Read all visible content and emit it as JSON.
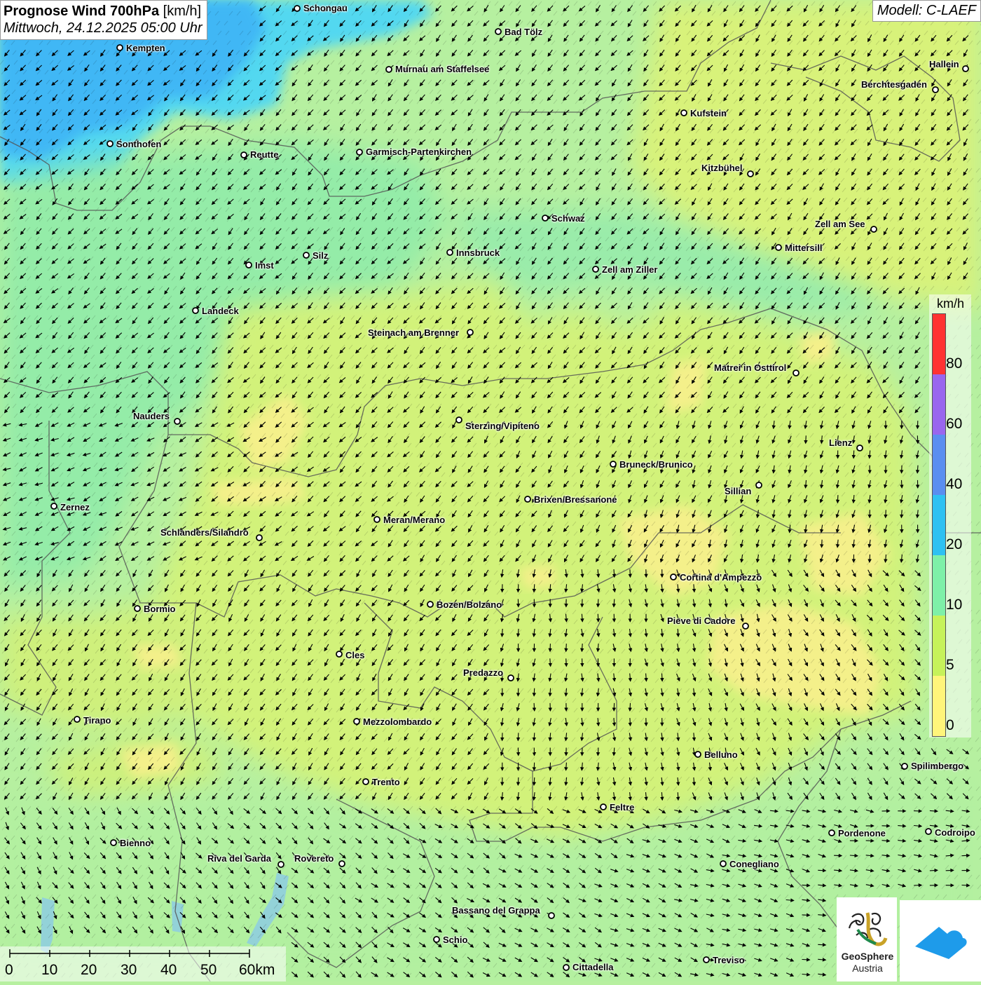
{
  "header": {
    "title": "Prognose Wind 700hPa",
    "unit": "[km/h]",
    "datetime": "Mittwoch, 24.12.2025 05:00 Uhr"
  },
  "model": "Modell: C-LAEF",
  "colors": {
    "calm_yellow": "#f4f08a",
    "low_green_yellow": "#d2f27a",
    "mid_green": "#a8f2a2",
    "teal_green": "#86eaa8",
    "sky_blue": "#52d8f0",
    "deep_blue": "#3fb7f5",
    "border_line": "#555555"
  },
  "legend": {
    "unit": "km/h",
    "labels": [
      "80",
      "60",
      "40",
      "20",
      "10",
      "5",
      "0"
    ],
    "segments": [
      {
        "color": "#ff3232"
      },
      {
        "color": "#9966ee"
      },
      {
        "color": "#5a8ef0"
      },
      {
        "color": "#2ec1f2"
      },
      {
        "color": "#7ef0a8"
      },
      {
        "color": "#c6f25a"
      },
      {
        "color": "#fff57a"
      }
    ]
  },
  "scale": {
    "labels": [
      "0",
      "10",
      "20",
      "30",
      "40",
      "50",
      "60km"
    ]
  },
  "logos": {
    "geosphere_line1": "GeoSphere",
    "geosphere_line2": "Austria",
    "geosphere_icon": "geosphere-swirl-icon",
    "app_icon": "weather-app-cloud-icon"
  },
  "cities": [
    {
      "name": "Schongau"
    },
    {
      "name": "Kempten"
    },
    {
      "name": "Bad Tölz"
    },
    {
      "name": "Murnau am Staffelsee"
    },
    {
      "name": "Hallein"
    },
    {
      "name": "Berchtesgaden"
    },
    {
      "name": "Kufstein"
    },
    {
      "name": "Sonthofen"
    },
    {
      "name": "Reutte"
    },
    {
      "name": "Garmisch-Partenkirchen"
    },
    {
      "name": "Kitzbühel"
    },
    {
      "name": "Schwaz"
    },
    {
      "name": "Zell am See"
    },
    {
      "name": "Mittersill"
    },
    {
      "name": "Innsbruck"
    },
    {
      "name": "Silz"
    },
    {
      "name": "Imst"
    },
    {
      "name": "Zell am Ziller"
    },
    {
      "name": "Landeck"
    },
    {
      "name": "Steinach am Brenner"
    },
    {
      "name": "Matrei in Osttirol"
    },
    {
      "name": "Nauders"
    },
    {
      "name": "Sterzing/Vipiteno"
    },
    {
      "name": "Lienz"
    },
    {
      "name": "Bruneck/Brunico"
    },
    {
      "name": "Sillian"
    },
    {
      "name": "Zernez"
    },
    {
      "name": "Brixen/Bressanone"
    },
    {
      "name": "Meran/Merano"
    },
    {
      "name": "Schlanders/Silandro"
    },
    {
      "name": "Cortina d'Ampezzo"
    },
    {
      "name": "Bozen/Bolzano"
    },
    {
      "name": "Bormio"
    },
    {
      "name": "Pieve di Cadore"
    },
    {
      "name": "Cles"
    },
    {
      "name": "Predazzo"
    },
    {
      "name": "Tirano"
    },
    {
      "name": "Mezzolombardo"
    },
    {
      "name": "Belluno"
    },
    {
      "name": "Spilimbergo"
    },
    {
      "name": "Trento"
    },
    {
      "name": "Feltre"
    },
    {
      "name": "Pordenone"
    },
    {
      "name": "Codroipo"
    },
    {
      "name": "Bienno"
    },
    {
      "name": "Riva del Garda"
    },
    {
      "name": "Rovereto"
    },
    {
      "name": "Conegliano"
    },
    {
      "name": "Bassano del Grappa"
    },
    {
      "name": "Schio"
    },
    {
      "name": "Treviso"
    },
    {
      "name": "Cittadella"
    }
  ]
}
